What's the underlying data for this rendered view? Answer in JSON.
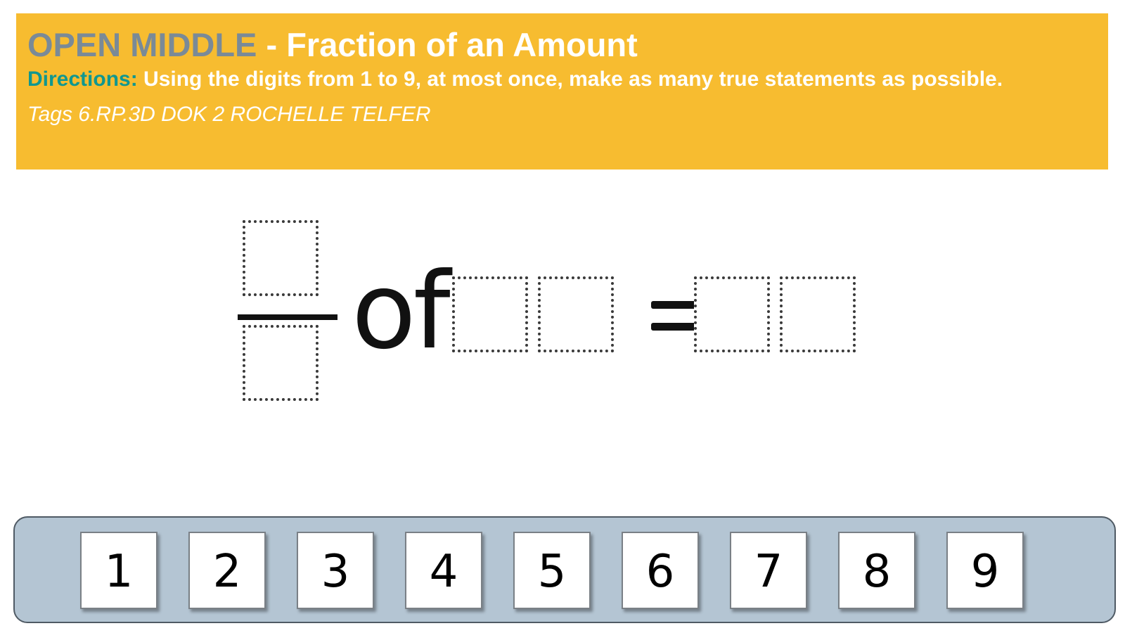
{
  "header": {
    "brand": "OPEN MIDDLE",
    "separator": " - ",
    "title": "Fraction of an Amount",
    "directions_label": "Directions:",
    "directions_text": " Using the digits from 1 to 9, at most once, make as many true statements as possible.",
    "tags": "Tags 6.RP.3D DOK 2 ROCHELLE TELFER"
  },
  "equation": {
    "word": "of",
    "symbol": "="
  },
  "digits": [
    "1",
    "2",
    "3",
    "4",
    "5",
    "6",
    "7",
    "8",
    "9"
  ],
  "colors": {
    "header_background": "#f7bc30",
    "brand": "#7a8a97",
    "directions_label": "#10978f",
    "tray_background": "#b4c5d3"
  }
}
